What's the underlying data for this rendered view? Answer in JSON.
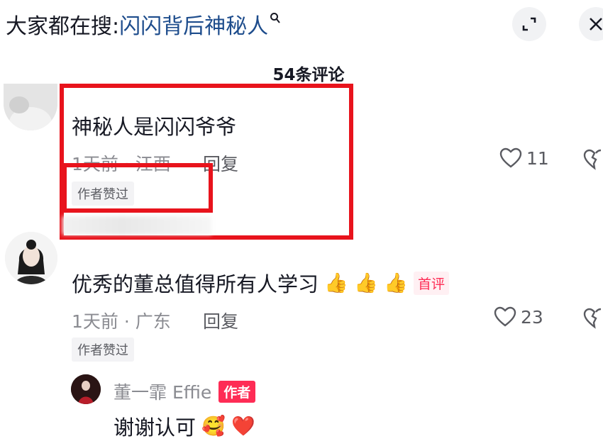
{
  "header": {
    "search_prefix": "大家都在搜:",
    "search_term": "闪闪背后神秘人",
    "search_icon": "search-icon",
    "expand_icon": "expand-icon",
    "close_icon": "close-icon"
  },
  "comment_count": "54条评论",
  "comments": [
    {
      "text": "神秘人是闪闪爷爷",
      "meta": "1天前 · 江西",
      "reply_label": "回复",
      "badge": "作者赞过",
      "likes": "11"
    },
    {
      "text": "优秀的董总值得所有人学习",
      "emojis": "👍 👍 👍",
      "first_badge": "首评",
      "meta": "1天前 · 广东",
      "reply_label": "回复",
      "badge": "作者赞过",
      "likes": "23"
    }
  ],
  "author_reply": {
    "name": "董一霏 Effie",
    "author_badge": "作者",
    "text": "谢谢认可",
    "emojis": "🥰 ❤️"
  },
  "colors": {
    "highlight_box": "#e8131c",
    "search_term": "#1d4c8c",
    "author_badge": "#fe2c55"
  }
}
